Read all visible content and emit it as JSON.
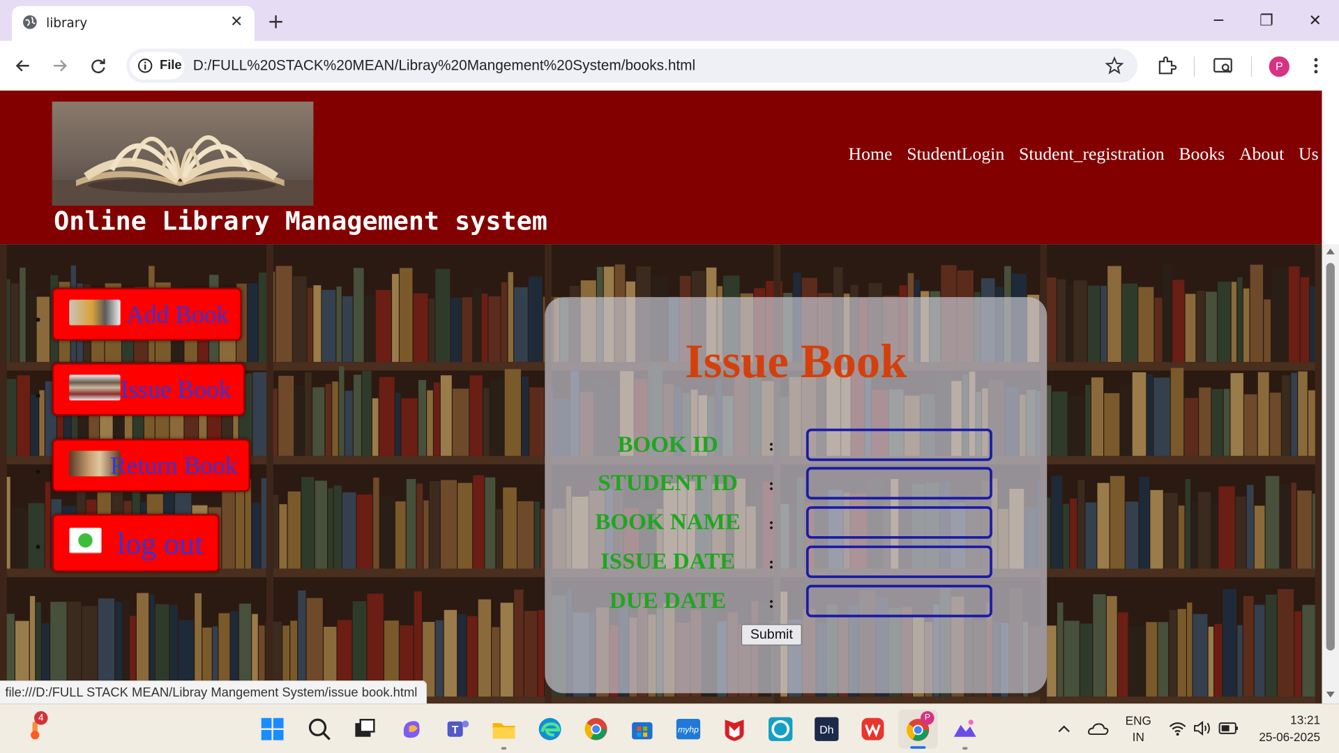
{
  "browser": {
    "tab_title": "library",
    "omnibox_chip": "File",
    "url": "D:/FULL%20STACK%20MEAN/Libray%20Mangement%20System/books.html",
    "profile_initial": "P"
  },
  "header": {
    "site_title": "Online Library Management system",
    "nav": [
      "Home",
      "StudentLogin",
      "Student_registration",
      "Books",
      "About",
      "Us"
    ]
  },
  "sidebar": {
    "items": [
      {
        "label": "Add Book"
      },
      {
        "label": "Issue Book"
      },
      {
        "label": "Return Book"
      },
      {
        "label": "log out"
      }
    ]
  },
  "form": {
    "title": "Issue Book",
    "fields": [
      {
        "label": "BOOK ID",
        "colon": ":",
        "value": ""
      },
      {
        "label": "STUDENT ID",
        "colon": ":",
        "value": ""
      },
      {
        "label": "BOOK NAME",
        "colon": ":",
        "value": ""
      },
      {
        "label": "ISSUE DATE",
        "colon": ":",
        "value": ""
      },
      {
        "label": "DUE DATE",
        "colon": ":",
        "value": ""
      }
    ],
    "submit_label": "Submit"
  },
  "status_url": "file:///D:/FULL STACK MEAN/Libray Mangement System/issue book.html",
  "taskbar": {
    "notification_badge": "4",
    "lang_top": "ENG",
    "lang_bottom": "IN",
    "time": "13:21",
    "date": "25-06-2025",
    "chrome_badge": "P"
  },
  "colors": {
    "header_bg": "#820000",
    "sidebar_button": "#ff0000",
    "sidebar_text": "#3535d6",
    "title_text": "#d4400c",
    "field_label": "#1fa61f",
    "input_border": "#1a1aa8"
  }
}
